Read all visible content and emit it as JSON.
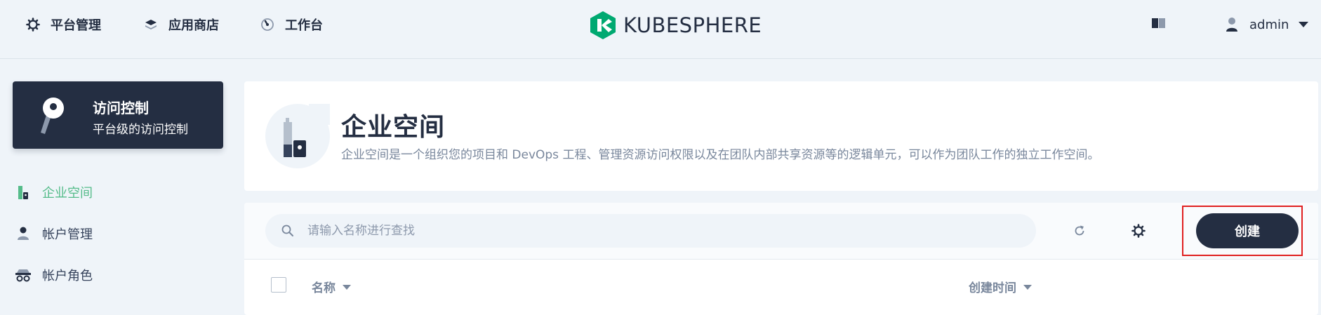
{
  "topnav": {
    "items": [
      {
        "label": "平台管理",
        "icon": "gear-icon"
      },
      {
        "label": "应用商店",
        "icon": "layers-icon"
      },
      {
        "label": "工作台",
        "icon": "dashboard-icon"
      }
    ],
    "logo_text": "KUBESPHERE",
    "user": {
      "name": "admin"
    }
  },
  "sidebar": {
    "card": {
      "title": "访问控制",
      "subtitle": "平台级的访问控制"
    },
    "items": [
      {
        "label": "企业空间",
        "icon": "workspace-icon",
        "active": true
      },
      {
        "label": "帐户管理",
        "icon": "user-icon",
        "active": false
      },
      {
        "label": "帐户角色",
        "icon": "role-icon",
        "active": false
      }
    ]
  },
  "header": {
    "title": "企业空间",
    "description": "企业空间是一个组织您的项目和 DevOps 工程、管理资源访问权限以及在团队内部共享资源等的逻辑单元，可以作为团队工作的独立工作空间。"
  },
  "toolbar": {
    "search_placeholder": "请输入名称进行查找",
    "create_label": "创建"
  },
  "table": {
    "columns": [
      "名称",
      "创建时间"
    ]
  },
  "colors": {
    "primary": "#242e42",
    "accent_green": "#55bc8a",
    "background": "#eff4f9",
    "highlight_red": "#e02020"
  }
}
